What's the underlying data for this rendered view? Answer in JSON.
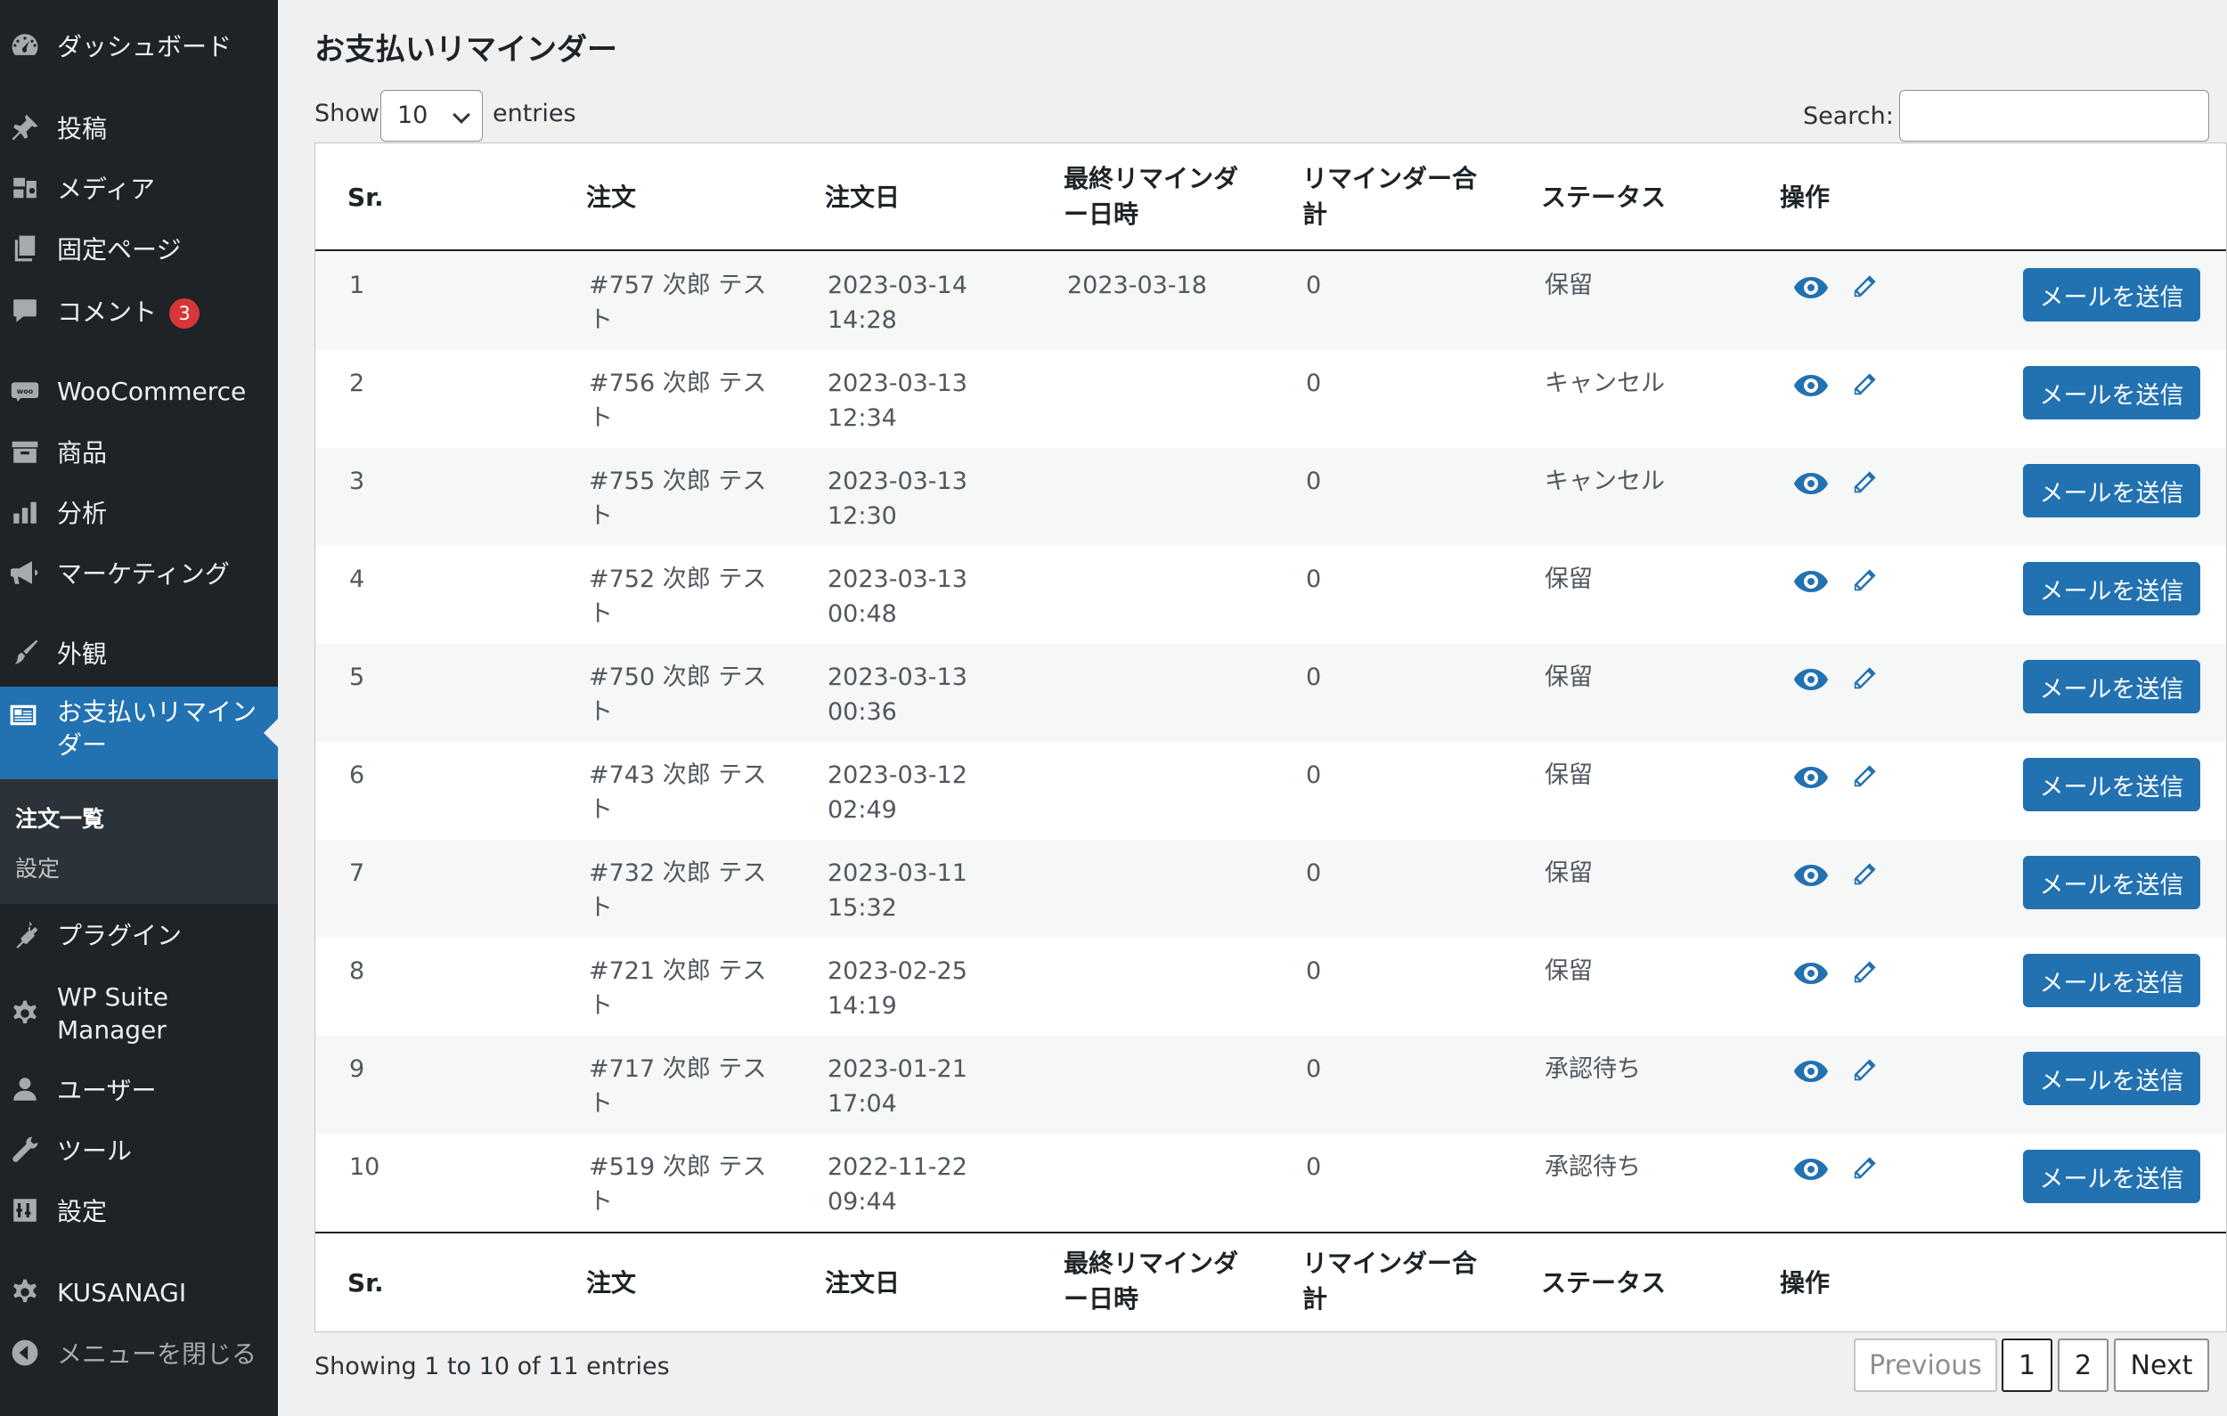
{
  "sidebar": {
    "items": [
      {
        "label": "ダッシュボード",
        "icon": "dashboard-icon"
      },
      {
        "label": "投稿",
        "icon": "pin-icon"
      },
      {
        "label": "メディア",
        "icon": "media-icon"
      },
      {
        "label": "固定ページ",
        "icon": "pages-icon"
      },
      {
        "label": "コメント",
        "icon": "comment-icon",
        "badge": "3"
      },
      {
        "label": "WooCommerce",
        "icon": "woo-icon"
      },
      {
        "label": "商品",
        "icon": "archive-icon"
      },
      {
        "label": "分析",
        "icon": "bar-chart-icon"
      },
      {
        "label": "マーケティング",
        "icon": "megaphone-icon"
      },
      {
        "label": "外観",
        "icon": "brush-icon"
      },
      {
        "label": "お支払いリマインダー",
        "icon": "reminder-icon"
      },
      {
        "label": "プラグイン",
        "icon": "plugin-icon"
      },
      {
        "label": "WP Suite Manager",
        "icon": "gear-icon"
      },
      {
        "label": "ユーザー",
        "icon": "user-icon"
      },
      {
        "label": "ツール",
        "icon": "wrench-icon"
      },
      {
        "label": "設定",
        "icon": "settings-icon"
      },
      {
        "label": "KUSANAGI",
        "icon": "gear-icon"
      },
      {
        "label": "メニューを閉じる",
        "icon": "collapse-icon"
      }
    ],
    "submenu": [
      {
        "label": "注文一覧",
        "current": true
      },
      {
        "label": "設定",
        "current": false
      }
    ]
  },
  "page": {
    "title": "お支払いリマインダー",
    "show_label": "Show",
    "entries_label": "entries",
    "length_value": "10",
    "search_label": "Search:",
    "search_value": ""
  },
  "table": {
    "columns": [
      "Sr.",
      "注文",
      "注文日",
      "最終リマインダー日時",
      "リマインダー合計",
      "ステータス",
      "操作"
    ],
    "rows": [
      {
        "sr": "1",
        "order": "#757 次郎 テスト",
        "date": "2023-03-14 14:28",
        "last_reminder": "2023-03-18",
        "total": "0",
        "status": "保留"
      },
      {
        "sr": "2",
        "order": "#756 次郎 テスト",
        "date": "2023-03-13 12:34",
        "last_reminder": "",
        "total": "0",
        "status": "キャンセル"
      },
      {
        "sr": "3",
        "order": "#755 次郎 テスト",
        "date": "2023-03-13 12:30",
        "last_reminder": "",
        "total": "0",
        "status": "キャンセル"
      },
      {
        "sr": "4",
        "order": "#752 次郎 テスト",
        "date": "2023-03-13 00:48",
        "last_reminder": "",
        "total": "0",
        "status": "保留"
      },
      {
        "sr": "5",
        "order": "#750 次郎 テスト",
        "date": "2023-03-13 00:36",
        "last_reminder": "",
        "total": "0",
        "status": "保留"
      },
      {
        "sr": "6",
        "order": "#743 次郎 テスト",
        "date": "2023-03-12 02:49",
        "last_reminder": "",
        "total": "0",
        "status": "保留"
      },
      {
        "sr": "7",
        "order": "#732 次郎 テスト",
        "date": "2023-03-11 15:32",
        "last_reminder": "",
        "total": "0",
        "status": "保留"
      },
      {
        "sr": "8",
        "order": "#721 次郎 テスト",
        "date": "2023-02-25 14:19",
        "last_reminder": "",
        "total": "0",
        "status": "保留"
      },
      {
        "sr": "9",
        "order": "#717 次郎 テスト",
        "date": "2023-01-21 17:04",
        "last_reminder": "",
        "total": "0",
        "status": "承認待ち"
      },
      {
        "sr": "10",
        "order": "#519 次郎 テスト",
        "date": "2022-11-22 09:44",
        "last_reminder": "",
        "total": "0",
        "status": "承認待ち"
      }
    ],
    "send_label": "メールを送信"
  },
  "footer": {
    "info": "Showing 1 to 10 of 11 entries",
    "previous": "Previous",
    "pages": [
      "1",
      "2"
    ],
    "next": "Next"
  },
  "colors": {
    "sidebar_bg": "#1d2327",
    "accent": "#2271b1",
    "badge": "#d63638"
  }
}
